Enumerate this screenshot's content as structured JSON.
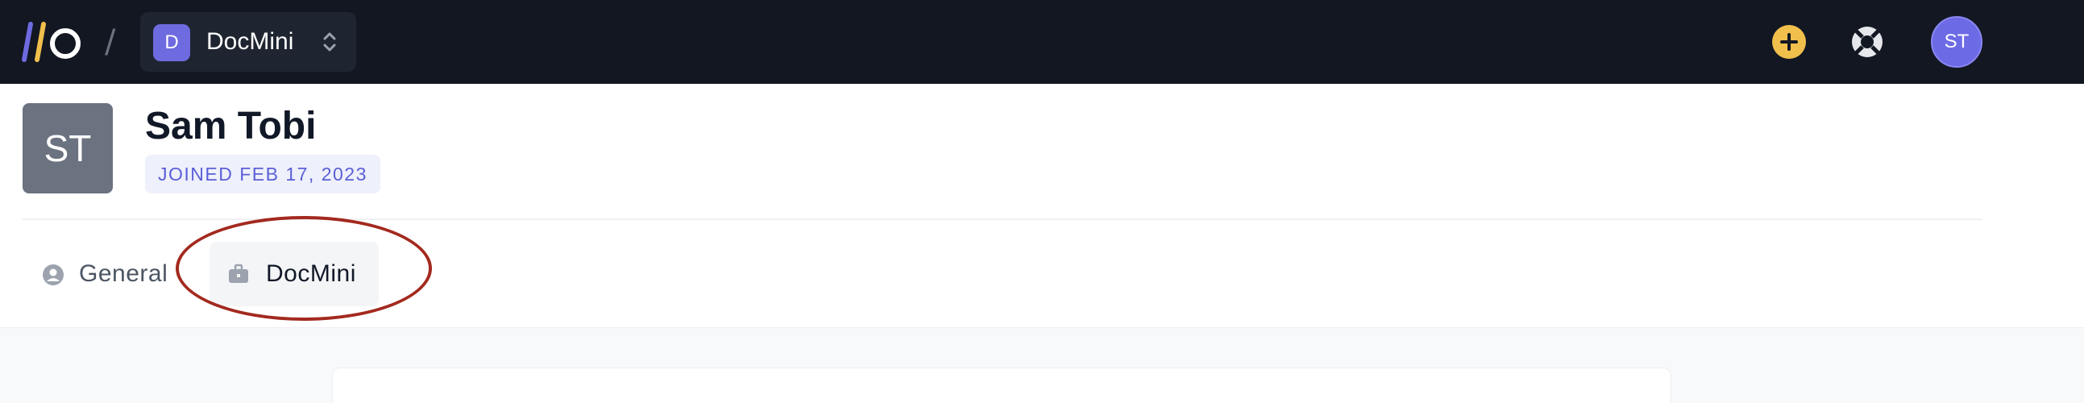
{
  "topbar": {
    "separator": "/",
    "workspace": {
      "initial": "D",
      "name": "DocMini"
    },
    "icons": {
      "logo": "app-logo",
      "add": "plus-icon",
      "help": "lifebuoy-icon",
      "caret": "chevron-up-down-icon"
    },
    "user_initials": "ST"
  },
  "profile": {
    "initials": "ST",
    "name": "Sam Tobi",
    "joined": "JOINED FEB 17, 2023"
  },
  "tabs": [
    {
      "label": "General",
      "icon": "user-circle-icon",
      "active": false
    },
    {
      "label": "DocMini",
      "icon": "briefcase-icon",
      "active": true
    }
  ],
  "colors": {
    "topbar_bg": "#121722",
    "accent": "#6e6ae0",
    "add_button": "#f1bf4c",
    "highlight": "#a3291e",
    "avatar_bg": "#6b7280"
  }
}
